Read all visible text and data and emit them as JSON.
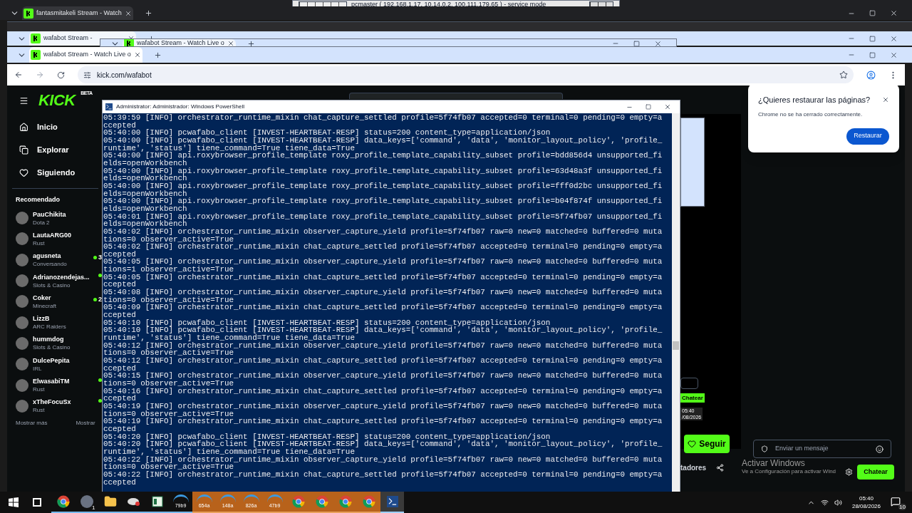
{
  "remote_bar": {
    "title": "pcmaster ( 192.168.1.17, 10.14.0.2, 100.111.179.65 ) - service mode"
  },
  "back_windows": [
    {
      "tab": {
        "title": "fantasmitakeli Stream - Watch",
        "selected": true
      }
    },
    {
      "tab": {
        "title": "wafabot Stream -",
        "selected": true
      }
    },
    {
      "tab": {
        "title": "wafabot Stream - Watch Live o",
        "selected": true
      }
    }
  ],
  "browser": {
    "tab": {
      "title": "wafabot Stream - Watch Live o",
      "selected": true
    },
    "url": "kick.com/wafabot"
  },
  "kick": {
    "logo": "KICK",
    "logo_badge": "BETA",
    "nav": [
      {
        "label": "Inicio",
        "kind": "home"
      },
      {
        "label": "Explorar",
        "kind": "explore"
      },
      {
        "label": "Siguiendo",
        "kind": "following"
      }
    ],
    "section_title": "Recomendado",
    "channels": [
      {
        "name": "PauChikita",
        "category": "Dota 2",
        "live": false
      },
      {
        "name": "LautaARG00",
        "category": "Rust",
        "live": false
      },
      {
        "name": "agusneta",
        "category": "Conversando",
        "live": true,
        "viewers": "3"
      },
      {
        "name": "Adrianozendejas...",
        "category": "Slots & Casino",
        "live": true
      },
      {
        "name": "Coker",
        "category": "Minecraft",
        "live": true,
        "viewers": "2"
      },
      {
        "name": "LizzB",
        "category": "ARC Raiders",
        "live": false
      },
      {
        "name": "hummdog",
        "category": "Slots & Casino",
        "live": false
      },
      {
        "name": "DulcePepita",
        "category": "IRL",
        "live": false
      },
      {
        "name": "ElwasabiTM",
        "category": "Rust",
        "live": true
      },
      {
        "name": "xTheFocuSx",
        "category": "Rust",
        "live": true
      }
    ],
    "show_more": "Mostrar más",
    "show_less": "Mostrar",
    "follow_button": "Seguir",
    "viewers_label": "tadores",
    "chat": {
      "placeholder": "Enviar un mensaje",
      "send_button": "Chatear"
    },
    "preview": {
      "button": "Chatear",
      "time": "05:40",
      "date": "/08/2026"
    }
  },
  "restore_dialog": {
    "title": "¿Quieres restaurar las páginas?",
    "message": "Chrome no se ha cerrado correctamente.",
    "button": "Restaurar"
  },
  "activation": {
    "title": "Activar Windows",
    "message": "Ve a Configuración para activar Wind"
  },
  "powershell": {
    "title": "Administrator: Administrador: Windows PowerShell",
    "lines": [
      "05:39:59 [INFO] orchestrator_runtime_mixin chat_capture_settled profile=5f74fb07 accepted=0 terminal=0 pending=0 empty=a",
      "ccepted",
      "05:40:00 [INFO] pcwafabo_client [INVEST-HEARTBEAT-RESP] status=200 content_type=application/json",
      "05:40:00 [INFO] pcwafabo_client [INVEST-HEARTBEAT-RESP] data_keys=['command', 'data', 'monitor_layout_policy', 'profile_",
      "runtime', 'status'] tiene_command=True tiene_data=True",
      "05:40:00 [INFO] api.roxybrowser_profile_template roxy_profile_template_capability_subset profile=bdd856d4 unsupported_fi",
      "elds=openWorkbench",
      "05:40:00 [INFO] api.roxybrowser_profile_template roxy_profile_template_capability_subset profile=63d48a3f unsupported_fi",
      "elds=openWorkbench",
      "05:40:00 [INFO] api.roxybrowser_profile_template roxy_profile_template_capability_subset profile=fff0d2bc unsupported_fi",
      "elds=openWorkbench",
      "05:40:00 [INFO] api.roxybrowser_profile_template roxy_profile_template_capability_subset profile=b04f874f unsupported_fi",
      "elds=openWorkbench",
      "05:40:01 [INFO] api.roxybrowser_profile_template roxy_profile_template_capability_subset profile=5f74fb07 unsupported_fi",
      "elds=openWorkbench",
      "05:40:02 [INFO] orchestrator_runtime_mixin observer_capture_yield profile=5f74fb07 raw=0 new=0 matched=0 buffered=0 muta",
      "tions=0 observer_active=True",
      "05:40:02 [INFO] orchestrator_runtime_mixin chat_capture_settled profile=5f74fb07 accepted=0 terminal=0 pending=0 empty=a",
      "ccepted",
      "05:40:05 [INFO] orchestrator_runtime_mixin observer_capture_yield profile=5f74fb07 raw=0 new=0 matched=0 buffered=0 muta",
      "tions=1 observer_active=True",
      "05:40:05 [INFO] orchestrator_runtime_mixin chat_capture_settled profile=5f74fb07 accepted=0 terminal=0 pending=0 empty=a",
      "ccepted",
      "05:40:08 [INFO] orchestrator_runtime_mixin observer_capture_yield profile=5f74fb07 raw=0 new=0 matched=0 buffered=0 muta",
      "tions=0 observer_active=True",
      "05:40:09 [INFO] orchestrator_runtime_mixin chat_capture_settled profile=5f74fb07 accepted=0 terminal=0 pending=0 empty=a",
      "ccepted",
      "05:40:10 [INFO] pcwafabo_client [INVEST-HEARTBEAT-RESP] status=200 content_type=application/json",
      "05:40:10 [INFO] pcwafabo_client [INVEST-HEARTBEAT-RESP] data_keys=['command', 'data', 'monitor_layout_policy', 'profile_",
      "runtime', 'status'] tiene_command=True tiene_data=True",
      "05:40:12 [INFO] orchestrator_runtime_mixin observer_capture_yield profile=5f74fb07 raw=0 new=0 matched=0 buffered=0 muta",
      "tions=0 observer_active=True",
      "05:40:12 [INFO] orchestrator_runtime_mixin chat_capture_settled profile=5f74fb07 accepted=0 terminal=0 pending=0 empty=a",
      "ccepted",
      "05:40:15 [INFO] orchestrator_runtime_mixin observer_capture_yield profile=5f74fb07 raw=0 new=0 matched=0 buffered=0 muta",
      "tions=0 observer_active=True",
      "05:40:16 [INFO] orchestrator_runtime_mixin chat_capture_settled profile=5f74fb07 accepted=0 terminal=0 pending=0 empty=a",
      "ccepted",
      "05:40:19 [INFO] orchestrator_runtime_mixin observer_capture_yield profile=5f74fb07 raw=0 new=0 matched=0 buffered=0 muta",
      "tions=0 observer_active=True",
      "05:40:19 [INFO] orchestrator_runtime_mixin chat_capture_settled profile=5f74fb07 accepted=0 terminal=0 pending=0 empty=a",
      "ccepted",
      "05:40:20 [INFO] pcwafabo_client [INVEST-HEARTBEAT-RESP] status=200 content_type=application/json",
      "05:40:20 [INFO] pcwafabo_client [INVEST-HEARTBEAT-RESP] data_keys=['command', 'data', 'monitor_layout_policy', 'profile_",
      "runtime', 'status'] tiene_command=True tiene_data=True",
      "05:40:22 [INFO] orchestrator_runtime_mixin observer_capture_yield profile=5f74fb07 raw=0 new=0 matched=0 buffered=0 muta",
      "tions=0 observer_active=True",
      "05:40:22 [INFO] orchestrator_runtime_mixin chat_capture_settled profile=5f74fb07 accepted=0 terminal=0 pending=0 empty=a",
      "ccepted"
    ]
  },
  "taskbar": {
    "apps": [
      {
        "kind": "chrome",
        "flashing": false,
        "active": false
      },
      {
        "kind": "remote",
        "badge": "1",
        "flashing": false,
        "active": false
      },
      {
        "kind": "folder",
        "flashing": false,
        "active": false
      },
      {
        "kind": "satellite",
        "flashing": false,
        "active": false
      },
      {
        "kind": "sheet",
        "flashing": false,
        "active": false
      },
      {
        "kind": "session",
        "label": "79b9",
        "flashing": false,
        "active": false
      },
      {
        "kind": "session",
        "label": "654a",
        "flashing": true,
        "active": false
      },
      {
        "kind": "session",
        "label": "148a",
        "flashing": true,
        "active": false
      },
      {
        "kind": "session",
        "label": "826a",
        "flashing": true,
        "active": false
      },
      {
        "kind": "session",
        "label": "47b9",
        "flashing": true,
        "active": false
      },
      {
        "kind": "chrome",
        "flashing": true,
        "active": false
      },
      {
        "kind": "chrome",
        "flashing": true,
        "active": false
      },
      {
        "kind": "chrome",
        "flashing": true,
        "active": false
      },
      {
        "kind": "chrome",
        "flashing": true,
        "active": false
      },
      {
        "kind": "terminal",
        "flashing": false,
        "active": true
      }
    ],
    "time": "05:40",
    "date": "28/08/2026",
    "notifications": "10"
  }
}
